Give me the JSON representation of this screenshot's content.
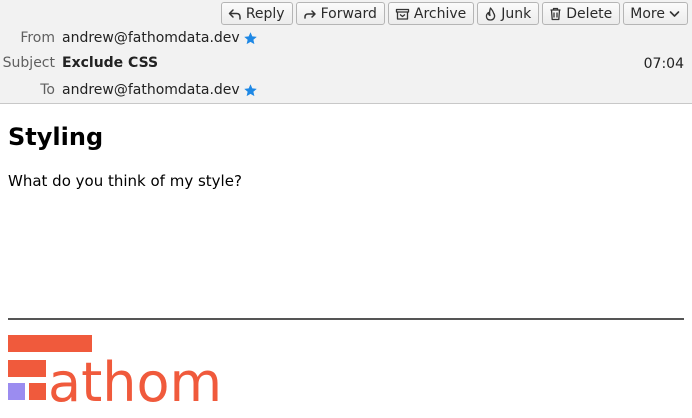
{
  "toolbar": {
    "reply_label": "Reply",
    "forward_label": "Forward",
    "archive_label": "Archive",
    "junk_label": "Junk",
    "delete_label": "Delete",
    "more_label": "More"
  },
  "headers": {
    "from_label": "From",
    "from_value": "andrew@fathomdata.dev",
    "subject_label": "Subject",
    "subject_value": "Exclude CSS",
    "to_label": "To",
    "to_value": "andrew@fathomdata.dev",
    "time": "07:04"
  },
  "message": {
    "heading": "Styling",
    "text": "What do you think of my style?"
  },
  "signature": {
    "logo_text": "athom",
    "brand_color": "#f05a3c",
    "accent_color": "#9b8cf0"
  },
  "colors": {
    "star": "#1e88e5"
  }
}
